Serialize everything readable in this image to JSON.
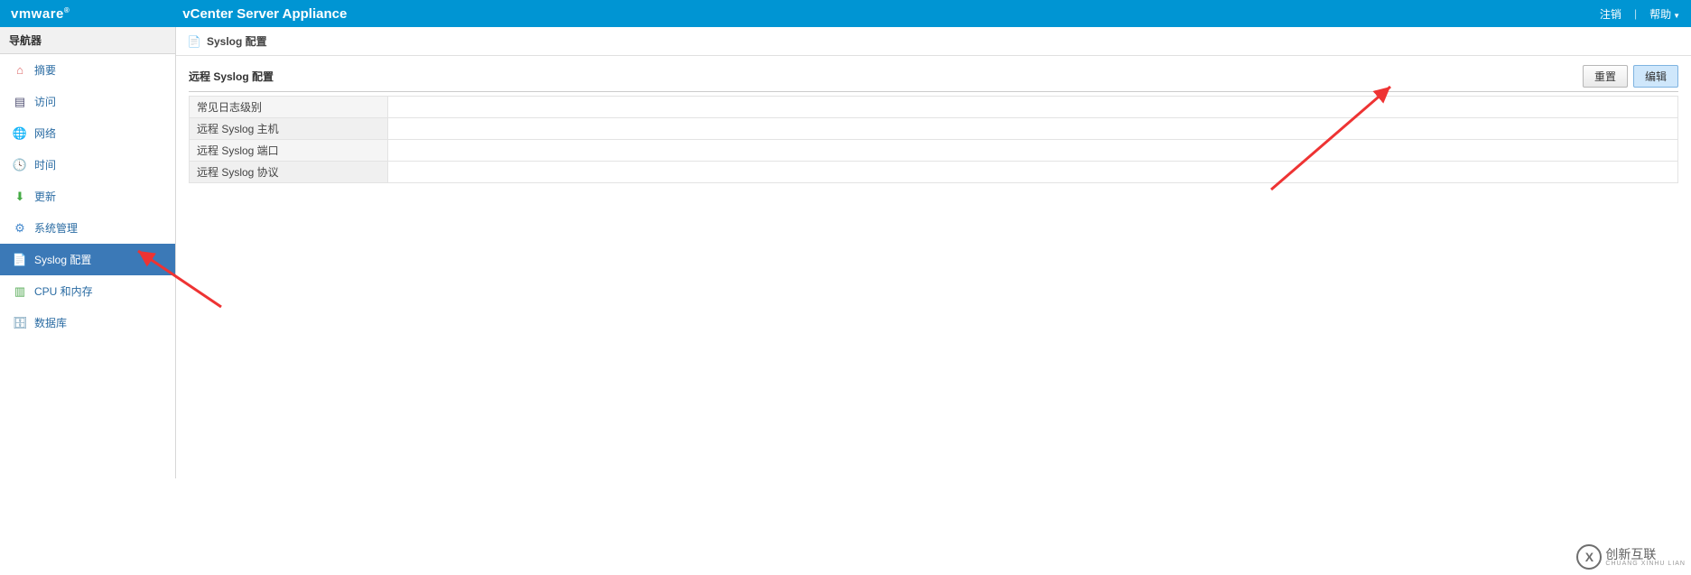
{
  "header": {
    "logo_text": "vmware",
    "app_title": "vCenter Server Appliance",
    "logout": "注销",
    "help": "帮助"
  },
  "sidebar": {
    "title": "导航器",
    "items": [
      {
        "icon": "home-icon",
        "label": "摘要"
      },
      {
        "icon": "access-icon",
        "label": "访问"
      },
      {
        "icon": "network-icon",
        "label": "网络"
      },
      {
        "icon": "time-icon",
        "label": "时间"
      },
      {
        "icon": "update-icon",
        "label": "更新"
      },
      {
        "icon": "admin-icon",
        "label": "系统管理"
      },
      {
        "icon": "syslog-icon",
        "label": "Syslog 配置",
        "selected": true
      },
      {
        "icon": "cpu-icon",
        "label": "CPU 和内存"
      },
      {
        "icon": "db-icon",
        "label": "数据库"
      }
    ]
  },
  "page": {
    "icon": "syslog-page-icon",
    "title": "Syslog 配置"
  },
  "section": {
    "title": "远程 Syslog 配置",
    "reset_label": "重置",
    "edit_label": "编辑",
    "rows": [
      {
        "label": "常见日志级别",
        "value": ""
      },
      {
        "label": "远程 Syslog 主机",
        "value": ""
      },
      {
        "label": "远程 Syslog 端口",
        "value": ""
      },
      {
        "label": "远程 Syslog 协议",
        "value": ""
      }
    ]
  },
  "watermark": {
    "brand": "创新互联",
    "sub": "CHUANG XINHU LIAN"
  }
}
